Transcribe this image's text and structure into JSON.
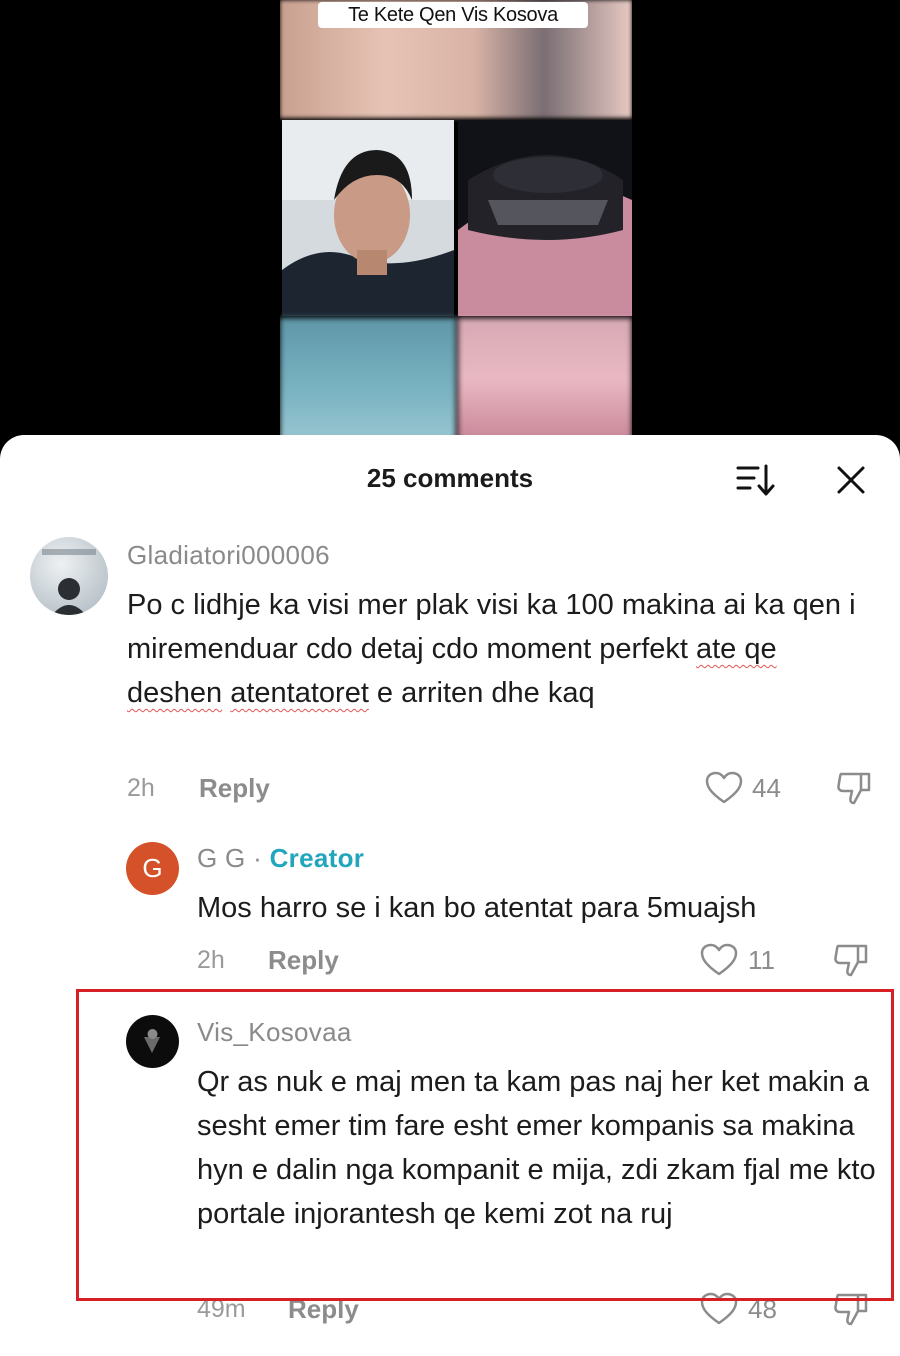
{
  "video": {
    "caption": "Te Kete Qen Vis Kosova"
  },
  "sheet": {
    "title": "25 comments"
  },
  "comments": [
    {
      "username": "Gladiatori000006",
      "text_before": "Po c lidhje ka visi mer plak visi ka 100 makina ai ka qen i miremenduar cdo detaj cdo moment perfekt ",
      "text_underlined_1": "ate qe deshen",
      "text_mid": " ",
      "text_underlined_2": "atentatoret",
      "text_after": " e arriten dhe kaq",
      "time": "2h",
      "reply_label": "Reply",
      "likes": "44"
    },
    {
      "avatar_letter": "G",
      "username": "G G",
      "separator": "·",
      "badge": "Creator",
      "text": "Mos harro se i kan bo atentat para 5muajsh",
      "time": "2h",
      "reply_label": "Reply",
      "likes": "11"
    },
    {
      "username": "Vis_Kosovaa",
      "text": "Qr as nuk e maj men ta kam pas naj her ket makin a sesht emer tim fare esht emer kompanis sa makina hyn e dalin nga kompanit e mija, zdi zkam fjal me kto portale injorantesh qe kemi zot na ruj",
      "time": "49m",
      "reply_label": "Reply",
      "likes": "48"
    }
  ],
  "colors": {
    "creator": "#22a6bb",
    "highlight_box": "#d71f26",
    "avatar_orange": "#d4512a"
  }
}
